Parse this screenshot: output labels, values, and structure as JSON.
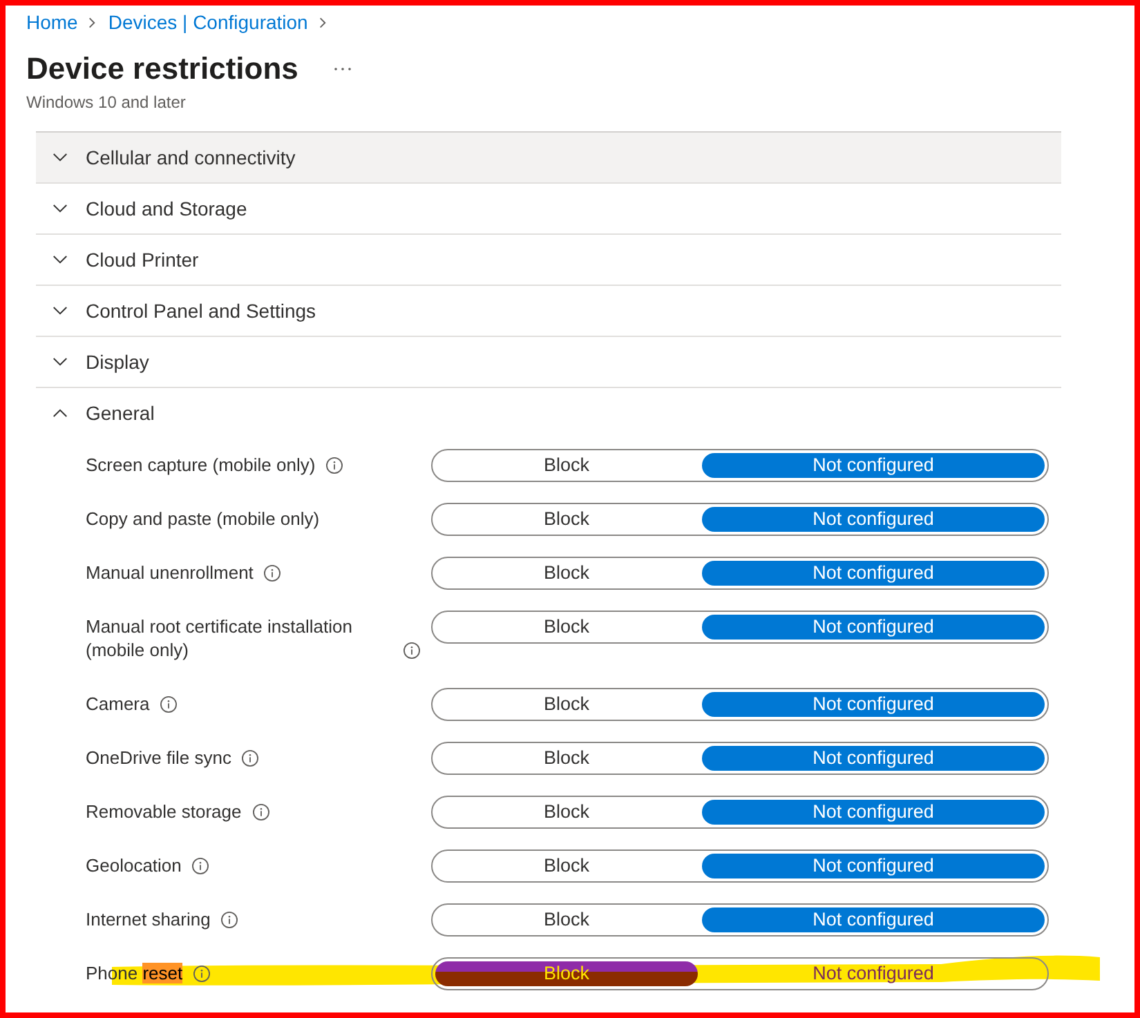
{
  "breadcrumb": [
    {
      "label": "Home"
    },
    {
      "label": "Devices | Configuration"
    }
  ],
  "page": {
    "title": "Device restrictions",
    "subtitle": "Windows 10 and later"
  },
  "sections": [
    {
      "title": "Cellular and connectivity",
      "expanded": false,
      "hovered": true
    },
    {
      "title": "Cloud and Storage",
      "expanded": false,
      "hovered": false
    },
    {
      "title": "Cloud Printer",
      "expanded": false,
      "hovered": false
    },
    {
      "title": "Control Panel and Settings",
      "expanded": false,
      "hovered": false
    },
    {
      "title": "Display",
      "expanded": false,
      "hovered": false
    },
    {
      "title": "General",
      "expanded": true,
      "hovered": false,
      "settings": [
        {
          "label_parts": [
            {
              "text": "Screen capture (mobile only)",
              "marked": false
            }
          ],
          "info": true,
          "highlighted": false,
          "options": [
            {
              "label": "Block",
              "selected": false
            },
            {
              "label": "Not configured",
              "selected": true
            }
          ]
        },
        {
          "label_parts": [
            {
              "text": "Copy and paste (mobile only)",
              "marked": false
            }
          ],
          "info": false,
          "highlighted": false,
          "options": [
            {
              "label": "Block",
              "selected": false
            },
            {
              "label": "Not configured",
              "selected": true
            }
          ]
        },
        {
          "label_parts": [
            {
              "text": "Manual unenrollment",
              "marked": false
            }
          ],
          "info": true,
          "highlighted": false,
          "options": [
            {
              "label": "Block",
              "selected": false
            },
            {
              "label": "Not configured",
              "selected": true
            }
          ]
        },
        {
          "label_parts": [
            {
              "text": "Manual root certificate installation (mobile only)",
              "marked": false
            }
          ],
          "info": true,
          "highlighted": false,
          "options": [
            {
              "label": "Block",
              "selected": false
            },
            {
              "label": "Not configured",
              "selected": true
            }
          ]
        },
        {
          "label_parts": [
            {
              "text": "Camera",
              "marked": false
            }
          ],
          "info": true,
          "highlighted": false,
          "options": [
            {
              "label": "Block",
              "selected": false
            },
            {
              "label": "Not configured",
              "selected": true
            }
          ]
        },
        {
          "label_parts": [
            {
              "text": "OneDrive file sync",
              "marked": false
            }
          ],
          "info": true,
          "highlighted": false,
          "options": [
            {
              "label": "Block",
              "selected": false
            },
            {
              "label": "Not configured",
              "selected": true
            }
          ]
        },
        {
          "label_parts": [
            {
              "text": "Removable storage",
              "marked": false
            }
          ],
          "info": true,
          "highlighted": false,
          "options": [
            {
              "label": "Block",
              "selected": false
            },
            {
              "label": "Not configured",
              "selected": true
            }
          ]
        },
        {
          "label_parts": [
            {
              "text": "Geolocation",
              "marked": false
            }
          ],
          "info": true,
          "highlighted": false,
          "options": [
            {
              "label": "Block",
              "selected": false
            },
            {
              "label": "Not configured",
              "selected": true
            }
          ]
        },
        {
          "label_parts": [
            {
              "text": "Internet sharing",
              "marked": false
            }
          ],
          "info": true,
          "highlighted": false,
          "options": [
            {
              "label": "Block",
              "selected": false
            },
            {
              "label": "Not configured",
              "selected": true
            }
          ]
        },
        {
          "label_parts": [
            {
              "text": "Phone",
              "marked": false
            },
            {
              "text": "reset",
              "marked": true
            }
          ],
          "info": true,
          "highlighted": true,
          "options": [
            {
              "label": "Block",
              "selected": true
            },
            {
              "label": "Not configured",
              "selected": false
            }
          ]
        }
      ]
    }
  ]
}
